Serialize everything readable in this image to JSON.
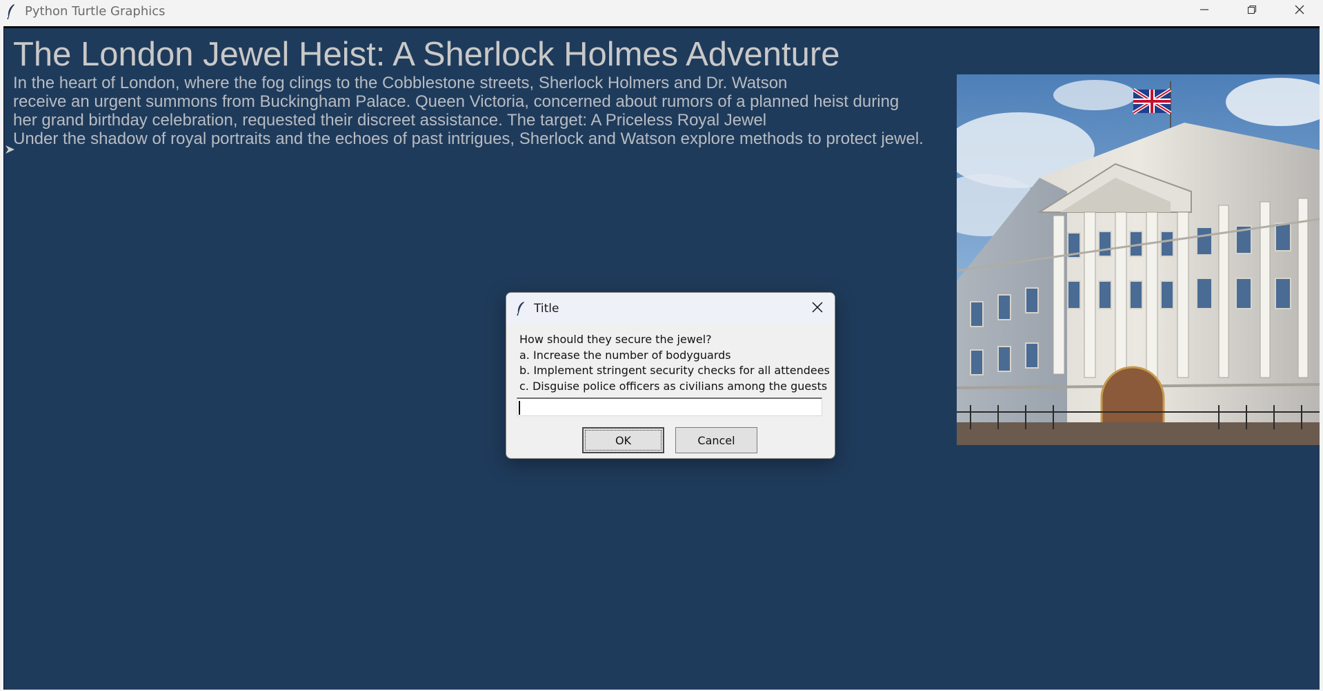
{
  "window": {
    "title": "Python Turtle Graphics",
    "icon": "feather-icon",
    "controls": [
      "minimize-icon",
      "restore-icon",
      "close-icon"
    ]
  },
  "canvas": {
    "background": "#1f3b5b",
    "title": "The London Jewel Heist: A Sherlock Holmes Adventure",
    "paragraphs": [
      "In the heart of London, where the fog clings to the Cobblestone streets, Sherlock Holmers and Dr. Watson",
      "receive an urgent summons from Buckingham Palace. Queen Victoria, concerned about rumors of a planned heist during",
      "her grand birthday celebration, requested their discreet assistance. The target: A Priceless Royal Jewel",
      "Under the shadow of royal portraits and the echoes of past intrigues, Sherlock and Watson explore methods to protect jewel."
    ],
    "image": "buckingham-palace-image"
  },
  "dialog": {
    "title": "Title",
    "prompt_lines": [
      "How should they secure the jewel?",
      "a. Increase the number of bodyguards",
      "b. Implement stringent security checks for all attendees",
      "c. Disguise police officers as civilians among the guests"
    ],
    "input_value": "",
    "ok_label": "OK",
    "cancel_label": "Cancel"
  }
}
